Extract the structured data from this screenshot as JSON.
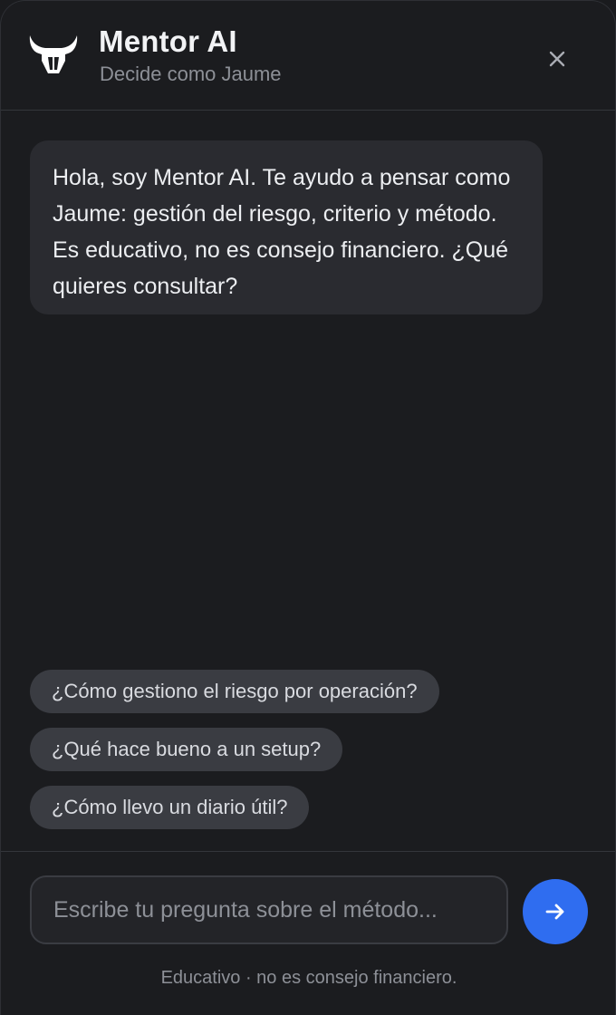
{
  "header": {
    "logo_icon": "bull-head-icon",
    "title": "Mentor AI",
    "subtitle": "Decide como  Jaume",
    "close_icon": "close-icon"
  },
  "chat": {
    "messages": [
      {
        "role": "assistant",
        "text": "Hola, soy Mentor AI. Te ayudo a pensar como  Jaume: gestión del riesgo, criterio y método. Es educativo, no es consejo financiero. ¿Qué quieres consultar?"
      }
    ]
  },
  "suggestions": [
    "¿Cómo gestiono el riesgo por operación?",
    "¿Qué hace bueno a un setup?",
    "¿Cómo llevo un diario útil?"
  ],
  "composer": {
    "placeholder": "Escribe tu pregunta sobre el método...",
    "value": "",
    "send_icon": "arrow-right-icon",
    "disclaimer": "Educativo · no es consejo financiero."
  },
  "colors": {
    "background": "#1b1c1f",
    "bubble": "#2a2b30",
    "chip": "#3a3c42",
    "accent": "#2f6df0"
  }
}
